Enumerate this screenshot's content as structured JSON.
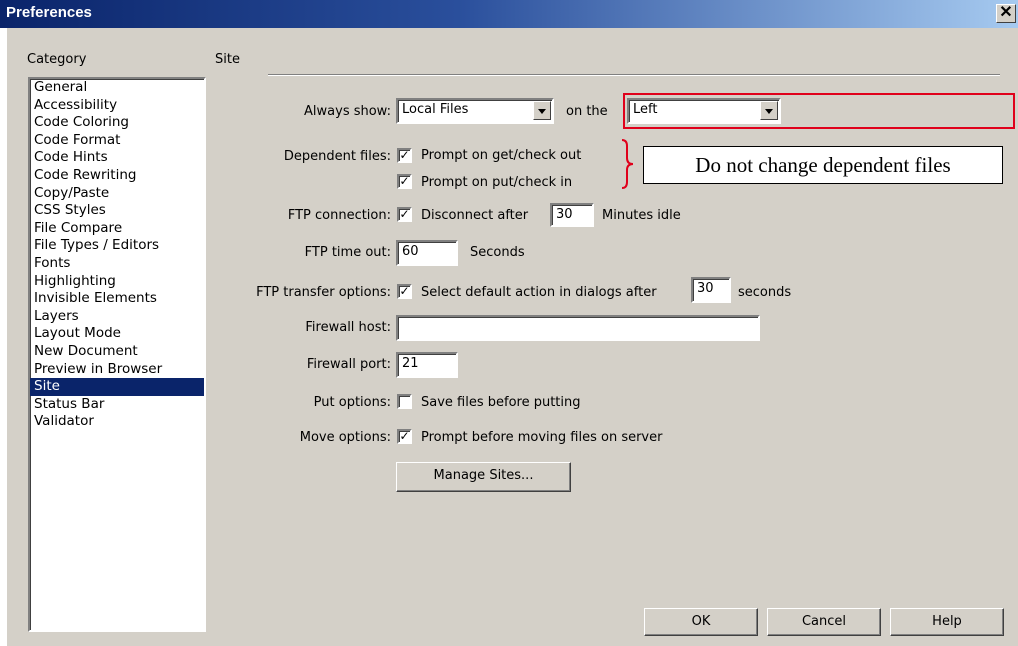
{
  "window": {
    "title": "Preferences",
    "close_glyph": "✕"
  },
  "category": {
    "header": "Category",
    "items": [
      "General",
      "Accessibility",
      "Code Coloring",
      "Code Format",
      "Code Hints",
      "Code Rewriting",
      "Copy/Paste",
      "CSS Styles",
      "File Compare",
      "File Types / Editors",
      "Fonts",
      "Highlighting",
      "Invisible Elements",
      "Layers",
      "Layout Mode",
      "New Document",
      "Preview in Browser",
      "Site",
      "Status Bar",
      "Validator"
    ],
    "selected": "Site"
  },
  "site": {
    "header": "Site",
    "always_show_label": "Always show:",
    "always_show_value": "Local Files",
    "on_the_label": "on the",
    "on_the_value": "Left",
    "dependent_files_label": "Dependent files:",
    "prompt_get_label": "Prompt on get/check out",
    "prompt_get_checked": true,
    "prompt_put_label": "Prompt on put/check in",
    "prompt_put_checked": true,
    "ftp_connection_label": "FTP connection:",
    "disconnect_label": "Disconnect after",
    "disconnect_checked": true,
    "disconnect_value": "30",
    "minutes_idle_label": "Minutes idle",
    "ftp_timeout_label": "FTP time out:",
    "ftp_timeout_value": "60",
    "seconds_label": "Seconds",
    "ftp_transfer_label": "FTP transfer options:",
    "select_default_label": "Select default action in dialogs after",
    "select_default_checked": true,
    "select_default_value": "30",
    "seconds_lower_label": "seconds",
    "firewall_host_label": "Firewall host:",
    "firewall_host_value": "",
    "firewall_port_label": "Firewall port:",
    "firewall_port_value": "21",
    "put_options_label": "Put options:",
    "save_before_label": "Save files before putting",
    "save_before_checked": false,
    "move_options_label": "Move options:",
    "prompt_move_label": "Prompt before moving files on server",
    "prompt_move_checked": true,
    "manage_sites_label": "Manage Sites..."
  },
  "buttons": {
    "ok": "OK",
    "cancel": "Cancel",
    "help": "Help"
  },
  "annotation": {
    "text": "Do not change dependent files",
    "highlight_color": "#e0001b"
  },
  "check_glyph": "✓"
}
